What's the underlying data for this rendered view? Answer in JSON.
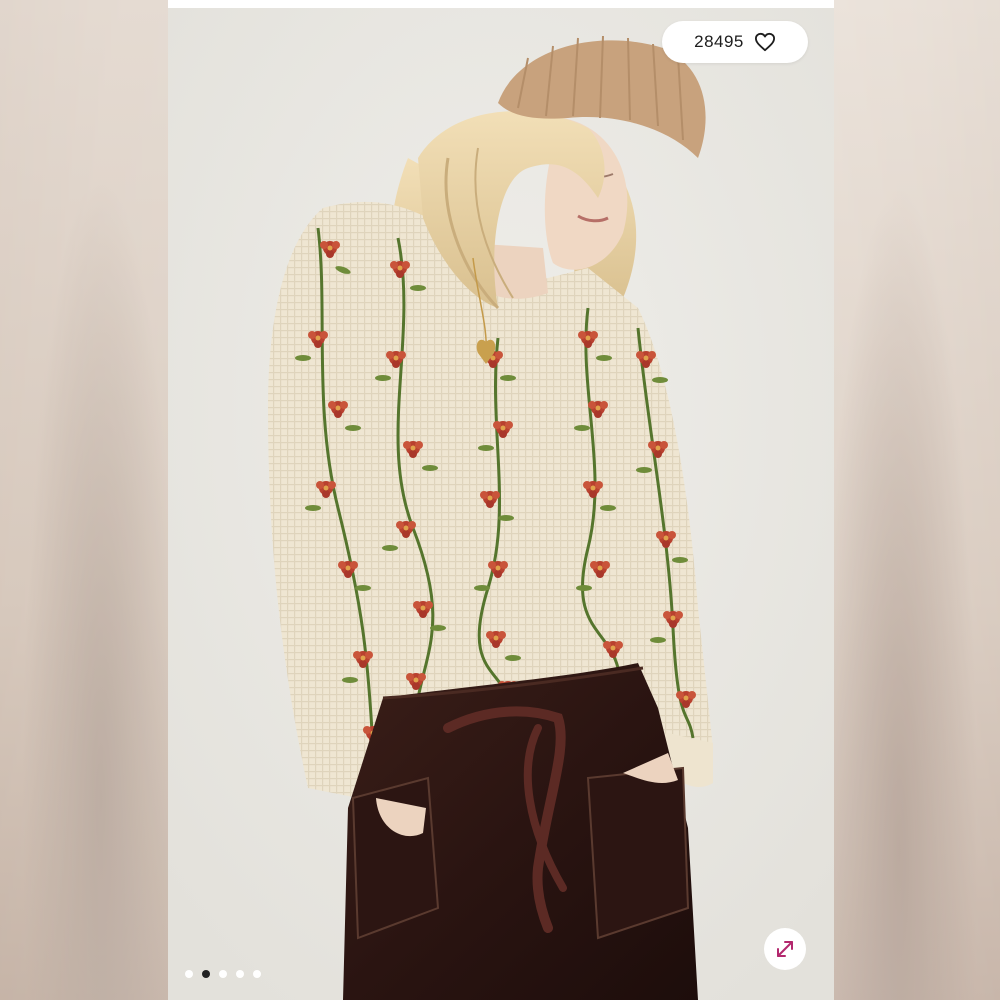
{
  "listing": {
    "like_count": "28495",
    "heart_icon": "heart-outline-icon",
    "expand_icon": "expand-diagonal-icon",
    "gallery": {
      "total_images": 5,
      "active_index": 1
    },
    "colors": {
      "accent": "#b3286e",
      "pill_bg": "#ffffff",
      "text": "#1d1d1d"
    }
  }
}
